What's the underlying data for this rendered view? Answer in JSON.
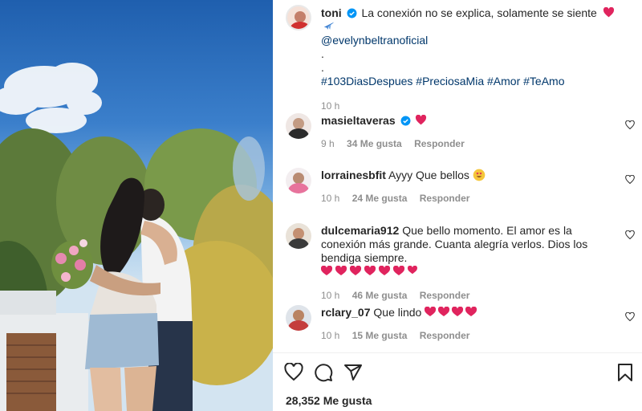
{
  "post": {
    "username": "toni",
    "caption": "La conexión no se explica, solamente se siente",
    "mention": "@evelynbeltranoficial",
    "dot1": ".",
    "dot2": ".",
    "hashtags": "#103DiasDespues #PreciosaMia #Amor #TeAmo",
    "time": "10 h",
    "likes": "28,352 Me gusta"
  },
  "comments": [
    {
      "username": "masieltaveras",
      "verified": true,
      "text": "",
      "time": "9 h",
      "likes": "34 Me gusta",
      "reply": "Responder"
    },
    {
      "username": "lorrainesbfit",
      "verified": false,
      "text": "Ayyy Que bellos",
      "time": "10 h",
      "likes": "24 Me gusta",
      "reply": "Responder"
    },
    {
      "username": "dulcemaria912",
      "verified": false,
      "text": "Que bello momento. El amor es la conexión más grande. Cuanta alegría verlos. Dios los bendiga siempre.",
      "time": "10 h",
      "likes": "46 Me gusta",
      "reply": "Responder"
    },
    {
      "username": "rclary_07",
      "verified": false,
      "text": "Que lindo",
      "time": "10 h",
      "likes": "15 Me gusta",
      "reply": "Responder"
    }
  ],
  "icons": {
    "like": "heart-outline-icon",
    "comment": "speech-bubble-icon",
    "share": "paper-plane-icon",
    "save": "bookmark-icon",
    "verified": "verified-badge-icon"
  },
  "colors": {
    "text": "#262626",
    "muted": "#8e8e8e",
    "link": "#00376b",
    "verified": "#0095f6",
    "heart": "#e0245e"
  }
}
